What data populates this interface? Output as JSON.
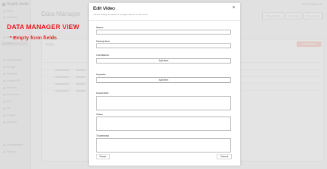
{
  "annotation": {
    "title": "DATA MANAGER VIEW",
    "subtitle": "* Empty form fields"
  },
  "background": {
    "brand": "Amplify Studio",
    "page_title": "Data Manager",
    "top_right": "Invite   sandbox-user",
    "top_buttons": [
      "Manage Models",
      "Seed data",
      "Auto-generate"
    ],
    "create_label": "Create video",
    "panel_title": "Video",
    "sidebar_items": [
      "Home",
      "Overview",
      "Set up",
      "Data",
      "Authentication",
      "Storage",
      "Functions",
      "Graphql API",
      "Analytics",
      "Predictions",
      "Geo",
      "File",
      "Content",
      "UI Library",
      "Documentation",
      "Support"
    ]
  },
  "modal": {
    "title": "Edit Video",
    "subtitle": "You are editing the details of a single instance of this model",
    "fields": {
      "name_label": "Name",
      "description_label": "Description",
      "conditions_label": "Conditions",
      "impacts_label": "Impacts",
      "document_label": "Document",
      "video_label": "Video",
      "thumbnail_label": "Thumbnail"
    },
    "values": {
      "name": "",
      "description": ""
    },
    "add_item_label": "Add item",
    "reset_label": "Reset",
    "submit_label": "Submit"
  }
}
